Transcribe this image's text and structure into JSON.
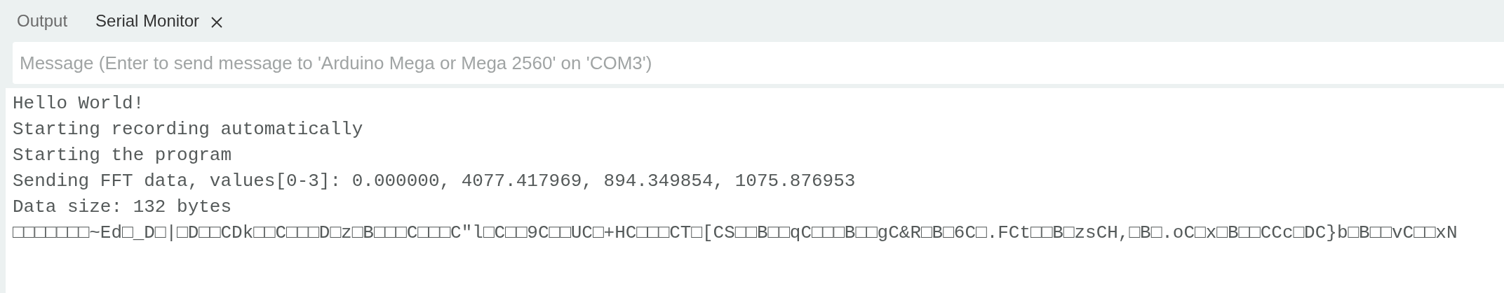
{
  "tabs": [
    {
      "label": "Output",
      "selected": false,
      "closable": false
    },
    {
      "label": "Serial Monitor",
      "selected": true,
      "closable": true
    }
  ],
  "message_field": {
    "placeholder": "Message (Enter to send message to 'Arduino Mega or Mega 2560' on 'COM3')"
  },
  "output_lines": [
    "Hello World!",
    "Starting recording automatically",
    "Starting the program",
    "Sending FFT data, values[0-3]: 0.000000, 4077.417969, 894.349854, 1075.876953",
    "Data size: 132 bytes",
    "□□□□□□□~Ed□_D□|□D□□CDk□□C□□□D□z□B□□□C□□□C\"l□C□□9C□□UC□+HC□□□CT□[CS□□B□□qC□□□B□□gC&R□B□6C□.FCt□□B□zsCH,□B□.oC□x□B□□CCc□DC}b□B□□vC□□xN"
  ]
}
